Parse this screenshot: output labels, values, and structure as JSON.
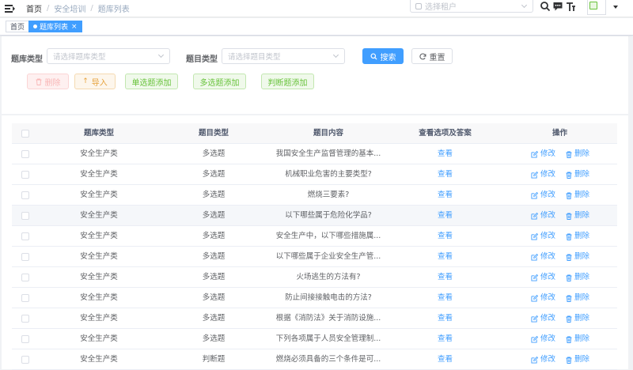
{
  "navbar": {
    "breadcrumb": [
      "首页",
      "安全培训",
      "题库列表"
    ],
    "tenant_placeholder": "选择租户"
  },
  "tags": {
    "home": "首页",
    "active": "题库列表",
    "close": "×"
  },
  "filters": {
    "bank_type_label": "题库类型",
    "bank_type_placeholder": "请选择题库类型",
    "question_type_label": "题目类型",
    "question_type_placeholder": "请选择题目类型",
    "search": "搜索",
    "reset": "重置"
  },
  "toolbar": {
    "delete": "删除",
    "import": "导入",
    "add_single": "单选题添加",
    "add_multi": "多选题添加",
    "add_judge": "判断题添加"
  },
  "table": {
    "headers": [
      "题库类型",
      "题目类型",
      "题目内容",
      "查看选项及答案",
      "操作"
    ],
    "view_label": "查看",
    "edit_label": "修改",
    "delete_label": "删除",
    "rows": [
      [
        "安全生产类",
        "多选题",
        "我国安全生产监督管理的基本..."
      ],
      [
        "安全生产类",
        "多选题",
        "机械职业危害的主要类型?"
      ],
      [
        "安全生产类",
        "多选题",
        "燃烧三要素?"
      ],
      [
        "安全生产类",
        "多选题",
        "以下哪些属于危险化学品?"
      ],
      [
        "安全生产类",
        "多选题",
        "安全生产中，以下哪些措施属..."
      ],
      [
        "安全生产类",
        "多选题",
        "以下哪些属于企业安全生产管..."
      ],
      [
        "安全生产类",
        "多选题",
        "火场逃生的方法有?"
      ],
      [
        "安全生产类",
        "多选题",
        "防止间接接触电击的方法?"
      ],
      [
        "安全生产类",
        "多选题",
        "根据《消防法》关于消防设施..."
      ],
      [
        "安全生产类",
        "多选题",
        "下列各项属于人员安全管理制..."
      ],
      [
        "安全生产类",
        "判断题",
        "燃烧必须具备的三个条件是可..."
      ]
    ]
  },
  "colors": {
    "primary": "#409eff",
    "danger": "#f56c6c",
    "warning": "#e6a23c",
    "success": "#67c23a"
  }
}
